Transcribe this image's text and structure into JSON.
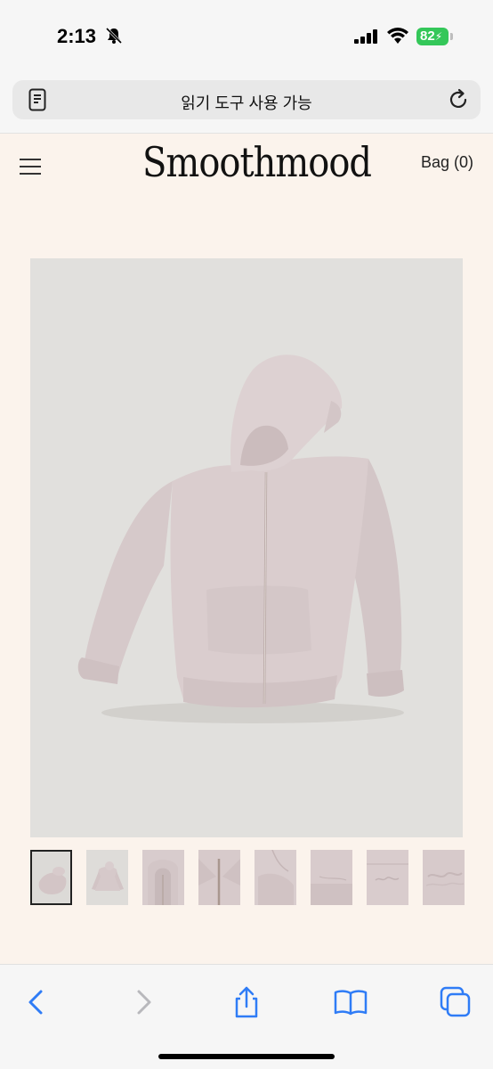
{
  "status_bar": {
    "time": "2:13",
    "battery": "82",
    "battery_color": "#34c759",
    "icons": [
      "bell-slash-icon",
      "signal-icon",
      "wifi-icon",
      "battery-icon"
    ]
  },
  "browser": {
    "address_text": "읽기 도구 사용 가능",
    "reader_icon": "reader-mode-icon",
    "reload_icon": "reload-icon"
  },
  "site": {
    "logo": "Smoothmood",
    "bag_label": "Bag (0)",
    "menu_icon": "hamburger-menu-icon"
  },
  "product": {
    "main_image": "pink-zip-hoodie",
    "thumbnails": [
      {
        "name": "hoodie-folded",
        "active": true
      },
      {
        "name": "hoodie-front-small",
        "active": false
      },
      {
        "name": "hoodie-hood-closeup",
        "active": false
      },
      {
        "name": "hoodie-zipper-closeup",
        "active": false
      },
      {
        "name": "hoodie-cuff-closeup",
        "active": false
      },
      {
        "name": "hoodie-hem-closeup",
        "active": false
      },
      {
        "name": "hoodie-logo-embroidery",
        "active": false
      },
      {
        "name": "hoodie-fabric-texture",
        "active": false
      }
    ]
  },
  "toolbar": {
    "buttons": [
      "back-icon",
      "forward-icon",
      "share-icon",
      "bookmarks-icon",
      "tabs-icon"
    ]
  },
  "colors": {
    "page_bg": "#fbf3ec",
    "image_bg": "#e1e0dd",
    "hoodie": "#d8cccd",
    "ios_blue": "#2f7cf6"
  }
}
